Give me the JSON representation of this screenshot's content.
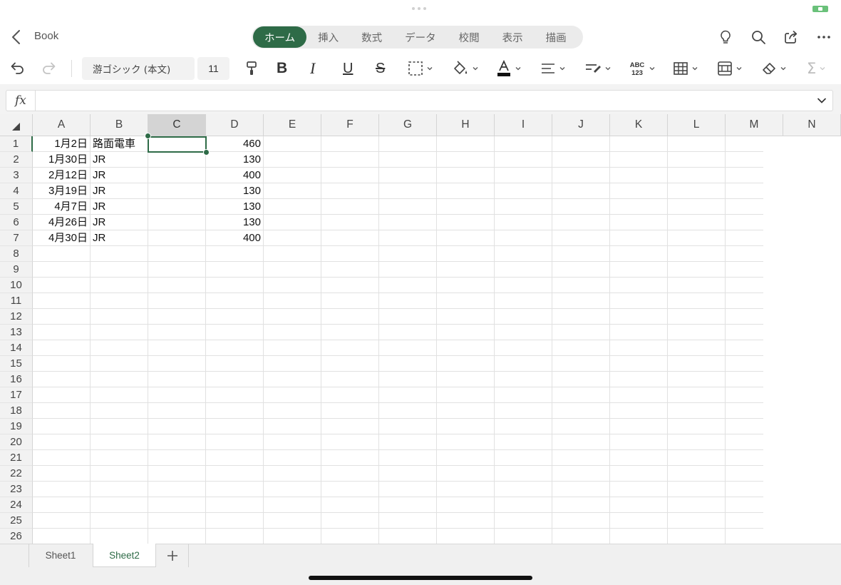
{
  "header": {
    "back_label": "Book",
    "tabs": [
      "ホーム",
      "挿入",
      "数式",
      "データ",
      "校閲",
      "表示",
      "描画"
    ],
    "active_tab": 0
  },
  "toolbar": {
    "font_name": "游ゴシック (本文)",
    "font_size": "11",
    "sum_symbol": "Σ",
    "bold": "B",
    "italic": "I",
    "underline": "U",
    "strike": "S"
  },
  "formula_bar": {
    "label": "fx",
    "value": ""
  },
  "sheet": {
    "columns": [
      "A",
      "B",
      "C",
      "D",
      "E",
      "F",
      "G",
      "H",
      "I",
      "J",
      "K",
      "L",
      "M",
      "N"
    ],
    "rows": [
      "1",
      "2",
      "3",
      "4",
      "5",
      "6",
      "7",
      "8",
      "9",
      "10",
      "11",
      "12",
      "13",
      "14",
      "15",
      "16",
      "17",
      "18",
      "19",
      "20",
      "21",
      "22",
      "23",
      "24",
      "25",
      "26"
    ],
    "selected_cell": "C1",
    "data": [
      {
        "A": "1月2日",
        "B": "路面電車",
        "D": "460"
      },
      {
        "A": "1月30日",
        "B": "JR",
        "D": "130"
      },
      {
        "A": "2月12日",
        "B": "JR",
        "D": "400"
      },
      {
        "A": "3月19日",
        "B": "JR",
        "D": "130"
      },
      {
        "A": "4月7日",
        "B": "JR",
        "D": "130"
      },
      {
        "A": "4月26日",
        "B": "JR",
        "D": "130"
      },
      {
        "A": "4月30日",
        "B": "JR",
        "D": "400"
      }
    ]
  },
  "sheet_tabs": [
    "Sheet1",
    "Sheet2"
  ],
  "active_sheet": 1,
  "colors": {
    "accent": "#2e6b47",
    "selected_header": "#d4d4d4",
    "header_bg": "#f2f2f2"
  }
}
